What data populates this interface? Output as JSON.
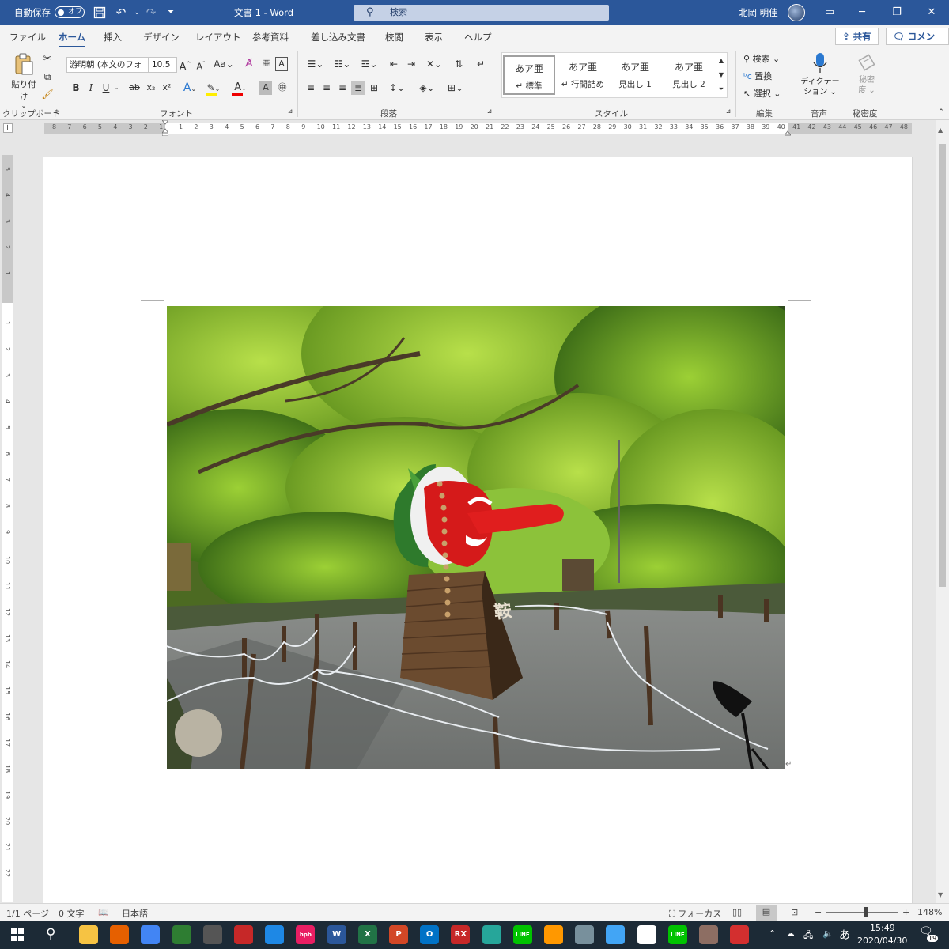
{
  "titlebar": {
    "autosave_label": "自動保存",
    "autosave_state": "オフ",
    "doc_title": "文書 1  -  Word",
    "search_placeholder": "検索",
    "user_name": "北岡 明佳"
  },
  "tabs": [
    "ファイル",
    "ホーム",
    "挿入",
    "デザイン",
    "レイアウト",
    "参考資料",
    "差し込み文書",
    "校閲",
    "表示",
    "ヘルプ"
  ],
  "active_tab": "ホーム",
  "share_label": "共有",
  "comment_label": "コメント",
  "ribbon": {
    "clipboard": {
      "paste_label": "貼り付け",
      "group_label": "クリップボード"
    },
    "font": {
      "font_name": "游明朝 (本文のフォ",
      "font_size": "10.5",
      "group_label": "フォント",
      "bold": "B",
      "italic": "I",
      "underline": "U",
      "strike": "ab",
      "sub": "x₂",
      "sup": "x²",
      "case": "Aa"
    },
    "paragraph": {
      "group_label": "段落"
    },
    "styles": {
      "group_label": "スタイル",
      "items": [
        {
          "sample": "あア亜",
          "name": "↵ 標準"
        },
        {
          "sample": "あア亜",
          "name": "↵ 行間詰め"
        },
        {
          "sample": "あア亜",
          "name": "見出し 1"
        },
        {
          "sample": "あア亜",
          "name": "見出し 2"
        }
      ]
    },
    "editing": {
      "group_label": "編集",
      "find": "検索",
      "replace": "置換",
      "select": "選択"
    },
    "voice": {
      "group_label": "音声",
      "dictate_line1": "ディクテー",
      "dictate_line2": "ション"
    },
    "sensitivity": {
      "group_label": "秘密度",
      "label_line1": "秘密",
      "label_line2": "度"
    }
  },
  "ruler": {
    "left_numbers": [
      "8",
      "7",
      "6",
      "5",
      "4",
      "3",
      "2",
      "1"
    ],
    "right_numbers": [
      "1",
      "2",
      "3",
      "4",
      "5",
      "6",
      "7",
      "8",
      "9",
      "10",
      "11",
      "12",
      "13",
      "14",
      "15",
      "16",
      "17",
      "18",
      "19",
      "20",
      "21",
      "22",
      "23",
      "24",
      "25",
      "26",
      "27",
      "28",
      "29",
      "30",
      "31",
      "32",
      "33",
      "34",
      "35",
      "36",
      "37",
      "38",
      "39",
      "40",
      "41",
      "42",
      "43",
      "44",
      "45",
      "46",
      "47",
      "48"
    ],
    "vertical_numbers_top": [
      "5",
      "4",
      "3",
      "2",
      "1"
    ],
    "vertical_numbers": [
      "1",
      "2",
      "3",
      "4",
      "5",
      "6",
      "7",
      "8",
      "9",
      "10",
      "11",
      "12",
      "13",
      "14",
      "15",
      "16",
      "17",
      "18",
      "19",
      "20",
      "21",
      "22"
    ]
  },
  "statusbar": {
    "page": "1/1 ページ",
    "words": "0 文字",
    "language": "日本語",
    "focus": "フォーカス",
    "zoom": "148%"
  },
  "taskbar": {
    "time": "15:49",
    "date": "2020/04/30",
    "ime": "あ",
    "notifications": "19",
    "apps": [
      {
        "name": "file-explorer",
        "label": "",
        "color": "#f6c343"
      },
      {
        "name": "firefox",
        "label": "",
        "color": "#e66000"
      },
      {
        "name": "chrome",
        "label": "",
        "color": "#4285f4"
      },
      {
        "name": "app-green",
        "label": "",
        "color": "#2e7d32"
      },
      {
        "name": "app-camera",
        "label": "",
        "color": "#555555"
      },
      {
        "name": "app-red",
        "label": "",
        "color": "#c62828"
      },
      {
        "name": "app-globe",
        "label": "",
        "color": "#1e88e5"
      },
      {
        "name": "hpb",
        "label": "hpb",
        "color": "#e91e63"
      },
      {
        "name": "word",
        "label": "W",
        "color": "#2b579a"
      },
      {
        "name": "excel",
        "label": "X",
        "color": "#217346"
      },
      {
        "name": "powerpoint",
        "label": "P",
        "color": "#d24726"
      },
      {
        "name": "outlook",
        "label": "O",
        "color": "#0072c6"
      },
      {
        "name": "rx",
        "label": "RX",
        "color": "#c62828"
      },
      {
        "name": "app-note",
        "label": "",
        "color": "#26a69a"
      },
      {
        "name": "line",
        "label": "LINE",
        "color": "#00c300"
      },
      {
        "name": "app-search",
        "label": "",
        "color": "#ff9800"
      },
      {
        "name": "app-viewer",
        "label": "",
        "color": "#78909c"
      },
      {
        "name": "app-mail",
        "label": "",
        "color": "#42a5f5"
      },
      {
        "name": "slack",
        "label": "",
        "color": "#ffffff"
      },
      {
        "name": "line2",
        "label": "LINE",
        "color": "#00c300"
      },
      {
        "name": "app-photo",
        "label": "",
        "color": "#8d6e63"
      },
      {
        "name": "app-red2",
        "label": "",
        "color": "#d32f2f"
      }
    ]
  },
  "colors": {
    "accent": "#2b579a",
    "taskbar": "#1c2a36"
  }
}
